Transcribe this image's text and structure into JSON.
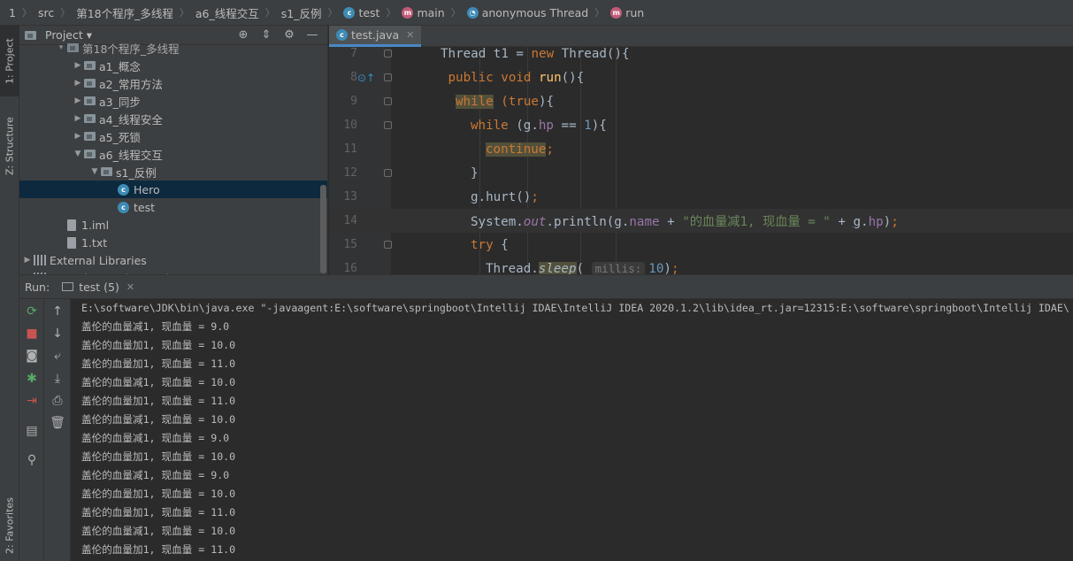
{
  "breadcrumb": {
    "root": "1",
    "items": [
      {
        "label": "src",
        "icon": ""
      },
      {
        "label": "第18个程序_多线程",
        "icon": ""
      },
      {
        "label": "a6_线程交互",
        "icon": ""
      },
      {
        "label": "s1_反例",
        "icon": ""
      },
      {
        "label": "test",
        "icon": "class-icon"
      },
      {
        "label": "main",
        "icon": "method-icon"
      },
      {
        "label": "anonymous Thread",
        "icon": "anonymous-class-icon"
      },
      {
        "label": "run",
        "icon": "method-icon"
      }
    ]
  },
  "left_stripe": {
    "project_tab": "1: Project",
    "structure_tab": "Z: Structure",
    "favorites_tab": "2: Favorites"
  },
  "project_panel": {
    "title": "Project",
    "tree": [
      {
        "label": "第18个程序_多线程",
        "indent": 2,
        "kind": "folder",
        "arrow": "▾",
        "partial": true
      },
      {
        "label": "a1_概念",
        "indent": 3,
        "kind": "folder",
        "arrow": "▶"
      },
      {
        "label": "a2_常用方法",
        "indent": 3,
        "kind": "folder",
        "arrow": "▶"
      },
      {
        "label": "a3_同步",
        "indent": 3,
        "kind": "folder",
        "arrow": "▶"
      },
      {
        "label": "a4_线程安全",
        "indent": 3,
        "kind": "folder",
        "arrow": "▶"
      },
      {
        "label": "a5_死锁",
        "indent": 3,
        "kind": "folder",
        "arrow": "▶"
      },
      {
        "label": "a6_线程交互",
        "indent": 3,
        "kind": "folder",
        "arrow": "▼"
      },
      {
        "label": "s1_反例",
        "indent": 4,
        "kind": "folder",
        "arrow": "▼"
      },
      {
        "label": "Hero",
        "indent": 5,
        "kind": "class",
        "arrow": "",
        "selected": true
      },
      {
        "label": "test",
        "indent": 5,
        "kind": "runclass",
        "arrow": ""
      },
      {
        "label": "1.iml",
        "indent": 2,
        "kind": "file",
        "arrow": ""
      },
      {
        "label": "1.txt",
        "indent": 2,
        "kind": "file",
        "arrow": ""
      },
      {
        "label": "External Libraries",
        "indent": 0,
        "kind": "lib",
        "arrow": "▶"
      },
      {
        "label": "Scratches and Consoles",
        "indent": 0,
        "kind": "lib",
        "arrow": "",
        "partial": true
      }
    ]
  },
  "editor": {
    "tab_label": "test.java",
    "lines": [
      {
        "num": "7",
        "html": "<span>Thread t1 = </span><span class=\"kw\">new </span><span>Thread(){</span>",
        "indent": 8
      },
      {
        "num": "8",
        "html": "<span class=\"kw\">public void </span><span class=\"fn\">run</span><span>(){</span>",
        "indent": 9
      },
      {
        "num": "9",
        "html": "<span class=\"kw hl\">while</span><span class=\"kw\"> (true</span><span>){</span>",
        "indent": 10
      },
      {
        "num": "10",
        "html": "<span class=\"kw\">while </span><span>(</span><span class=\"var\">g</span><span>.</span><span class=\"fld\">hp</span><span> == </span><span class=\"num\">1</span><span>){</span>",
        "indent": 12
      },
      {
        "num": "11",
        "html": "<span class=\"kw hl\">continue</span><span class=\"kw\">;</span>",
        "indent": 14
      },
      {
        "num": "12",
        "html": "<span>}</span>",
        "indent": 12
      },
      {
        "num": "13",
        "html": "<span class=\"var\">g</span><span>.hurt()</span><span class=\"kw\">;</span>",
        "indent": 12
      },
      {
        "num": "14",
        "html": "<span>System.</span><span class=\"st\">out</span><span>.println(</span><span class=\"var\">g</span><span>.</span><span class=\"fld\">name</span><span> + </span><span class=\"str\">\"的血量减1, 现血量 = \"</span><span> + </span><span class=\"var\">g</span><span>.</span><span class=\"fld\">hp</span><span>)</span><span class=\"kw\">;</span>",
        "indent": 12,
        "current": true
      },
      {
        "num": "15",
        "html": "<span class=\"kw\">try </span><span>{</span>",
        "indent": 12
      },
      {
        "num": "16",
        "html": "<span>Thread.</span><span class=\"ital hl\">sleep</span><span>( </span><span class=\"hint\">millis:</span><span class=\"num\">10</span><span>)</span><span class=\"kw\">;</span>",
        "indent": 14
      }
    ]
  },
  "run_panel": {
    "label": "Run:",
    "tab_label": "test (5)",
    "command": "E:\\software\\JDK\\bin\\java.exe \"-javaagent:E:\\software\\springboot\\Intellij IDAE\\IntelliJ IDEA 2020.1.2\\lib\\idea_rt.jar=12315:E:\\software\\springboot\\Intellij IDAE\\",
    "output": [
      "盖伦的血量减1, 现血量 = 9.0",
      "盖伦的血量加1, 现血量 = 10.0",
      "盖伦的血量加1, 现血量 = 11.0",
      "盖伦的血量减1, 现血量 = 10.0",
      "盖伦的血量加1, 现血量 = 11.0",
      "盖伦的血量减1, 现血量 = 10.0",
      "盖伦的血量减1, 现血量 = 9.0",
      "盖伦的血量加1, 现血量 = 10.0",
      "盖伦的血量减1, 现血量 = 9.0",
      "盖伦的血量加1, 现血量 = 10.0",
      "盖伦的血量加1, 现血量 = 11.0",
      "盖伦的血量减1, 现血量 = 10.0",
      "盖伦的血量加1, 现血量 = 11.0"
    ]
  }
}
